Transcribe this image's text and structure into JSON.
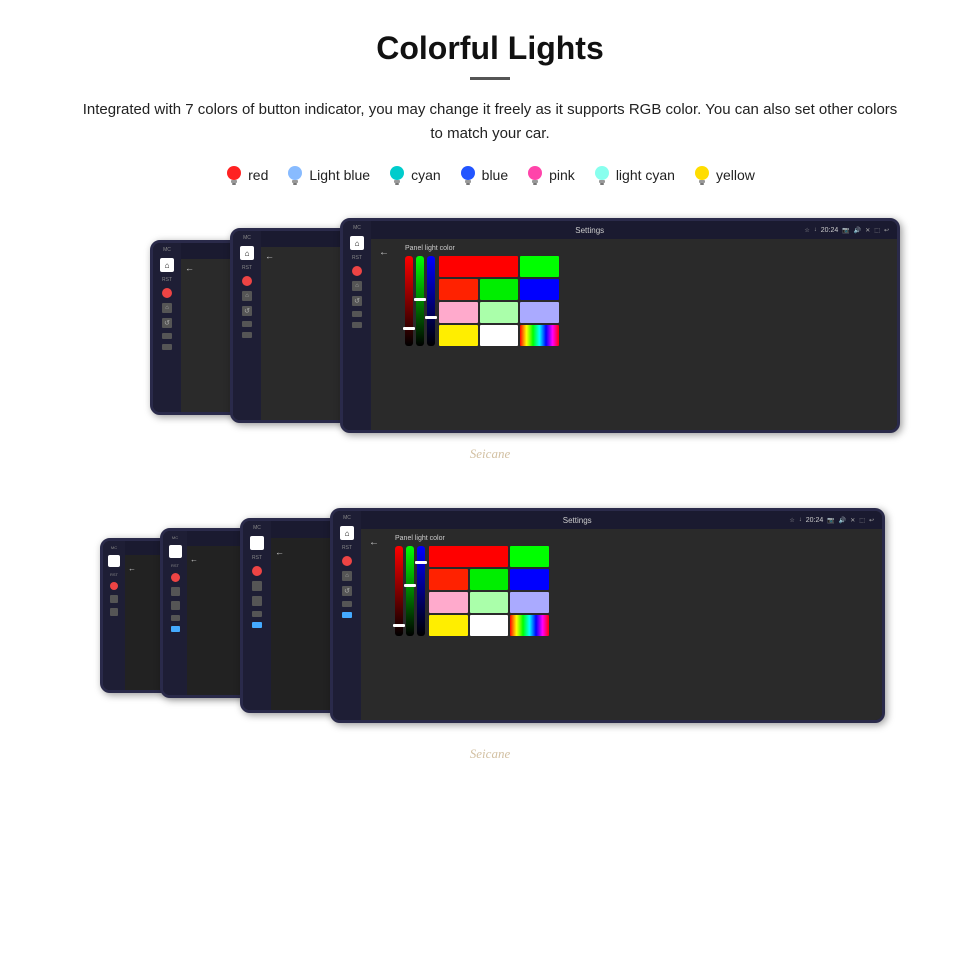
{
  "page": {
    "title": "Colorful Lights",
    "description": "Integrated with 7 colors of button indicator, you may change it freely as it supports RGB color. You can also set other colors to match your car.",
    "colors": [
      {
        "name": "red",
        "color": "#ff2222",
        "icon": "bulb"
      },
      {
        "name": "Light blue",
        "color": "#88bbff",
        "icon": "bulb"
      },
      {
        "name": "cyan",
        "color": "#00cccc",
        "icon": "bulb"
      },
      {
        "name": "blue",
        "color": "#2255ff",
        "icon": "bulb"
      },
      {
        "name": "pink",
        "color": "#ff44aa",
        "icon": "bulb"
      },
      {
        "name": "light cyan",
        "color": "#88ffee",
        "icon": "bulb"
      },
      {
        "name": "yellow",
        "color": "#ffdd00",
        "icon": "bulb"
      }
    ],
    "watermark": "Seicane",
    "settings_label": "Settings",
    "panel_light_color": "Panel light color",
    "time": "20:24",
    "back_arrow": "←"
  }
}
